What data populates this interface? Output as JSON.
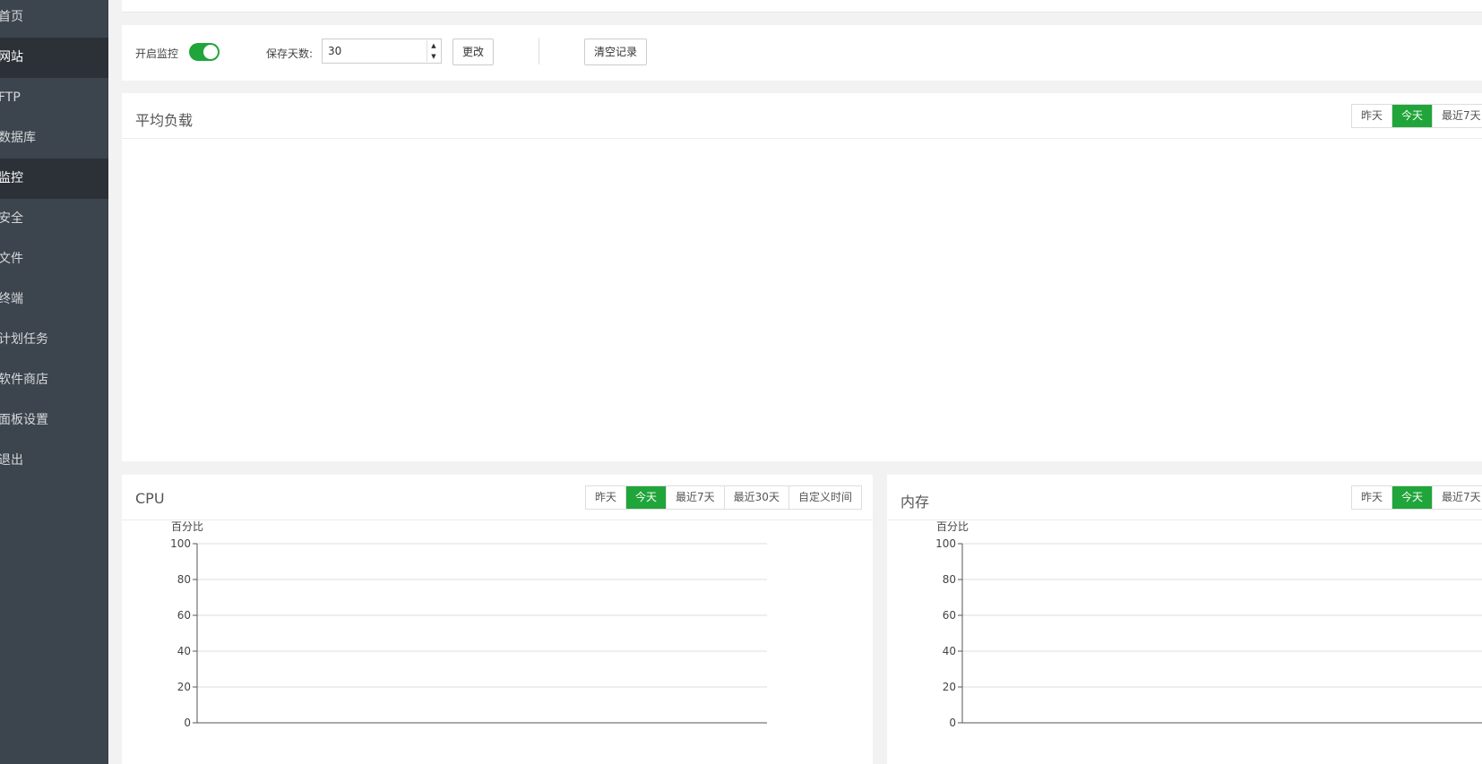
{
  "sidebar": {
    "items": [
      {
        "label": "首页"
      },
      {
        "label": "网站"
      },
      {
        "label": "FTP"
      },
      {
        "label": "数据库"
      },
      {
        "label": "监控"
      },
      {
        "label": "安全"
      },
      {
        "label": "文件"
      },
      {
        "label": "终端"
      },
      {
        "label": "计划任务"
      },
      {
        "label": "软件商店"
      },
      {
        "label": "面板设置"
      },
      {
        "label": "退出"
      }
    ]
  },
  "controls": {
    "monitor_label": "开启监控",
    "monitor_enabled": true,
    "retention_label": "保存天数:",
    "retention_value": "30",
    "update_button": "更改",
    "clear_button": "清空记录"
  },
  "load_card": {
    "title": "平均负载",
    "ranges": [
      "昨天",
      "今天",
      "最近7天"
    ],
    "selected": "今天"
  },
  "cpu_card": {
    "title": "CPU",
    "ranges": [
      "昨天",
      "今天",
      "最近7天",
      "最近30天",
      "自定义时间"
    ],
    "selected": "今天"
  },
  "mem_card": {
    "title": "内存",
    "ranges": [
      "昨天",
      "今天",
      "最近7天"
    ],
    "selected": "今天"
  },
  "chart_data": [
    {
      "type": "line",
      "title": "",
      "ylabel": "百分比",
      "xlabel": "",
      "ylim": [
        0,
        100
      ],
      "yticks": [
        "0",
        "20",
        "40",
        "60",
        "80",
        "100"
      ],
      "series": [],
      "grid": true
    },
    {
      "type": "line",
      "title": "",
      "ylabel": "百分比",
      "xlabel": "",
      "ylim": [
        0,
        100
      ],
      "yticks": [
        "0",
        "20",
        "40",
        "60",
        "80",
        "100"
      ],
      "series": [],
      "grid": true
    }
  ],
  "colors": {
    "accent": "#20a53a",
    "sidebar": "#3c444d",
    "sidebar_active": "#2c3138"
  }
}
